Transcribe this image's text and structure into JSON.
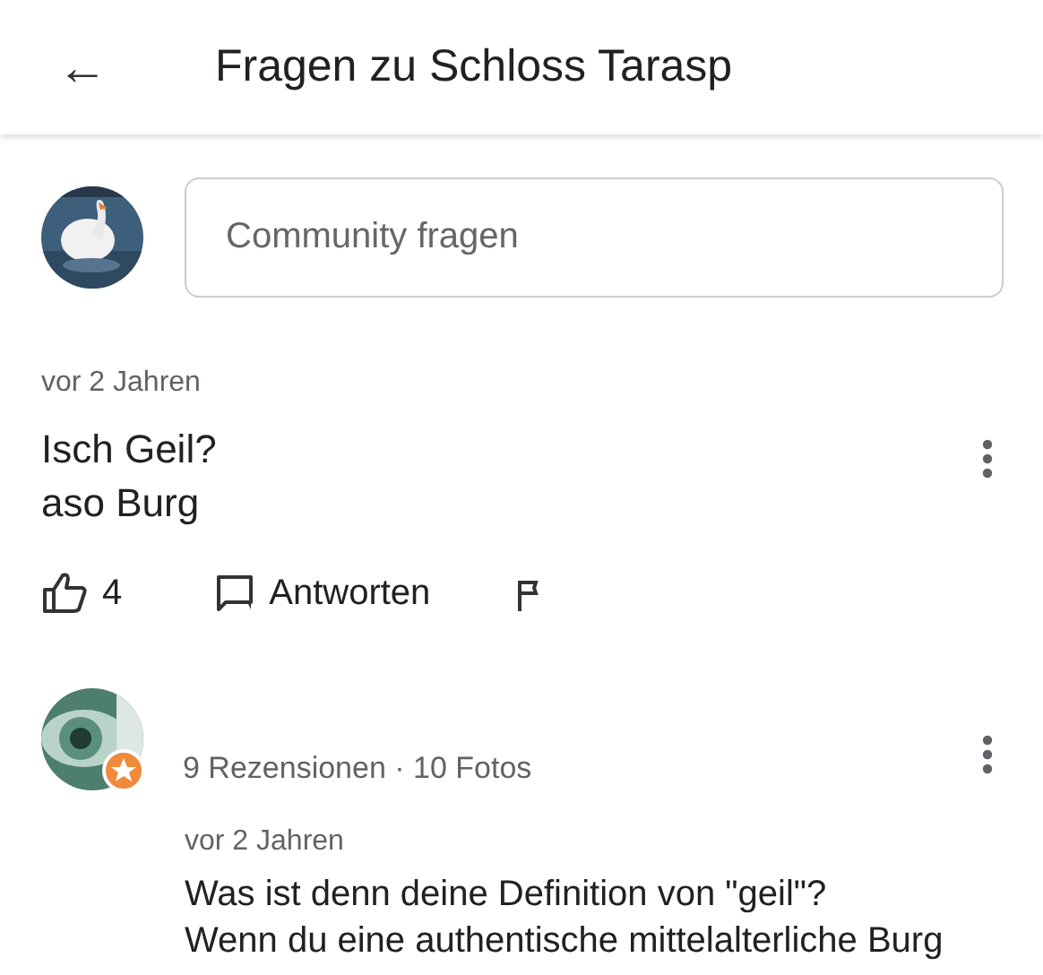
{
  "header": {
    "back": "←",
    "title": "Fragen zu Schloss Tarasp"
  },
  "ask": {
    "placeholder": "Community fragen"
  },
  "question": {
    "time": "vor 2 Jahren",
    "lines": [
      "Isch Geil?",
      "aso Burg"
    ],
    "likes": "4",
    "reply_label": "Antworten"
  },
  "answer": {
    "author_meta": "9 Rezensionen · 10 Fotos",
    "local_guide": true,
    "time": "vor 2 Jahren",
    "text": "Was ist denn deine Definition von \"geil\"?\nWenn du eine authentische mittelalterliche Burg"
  }
}
